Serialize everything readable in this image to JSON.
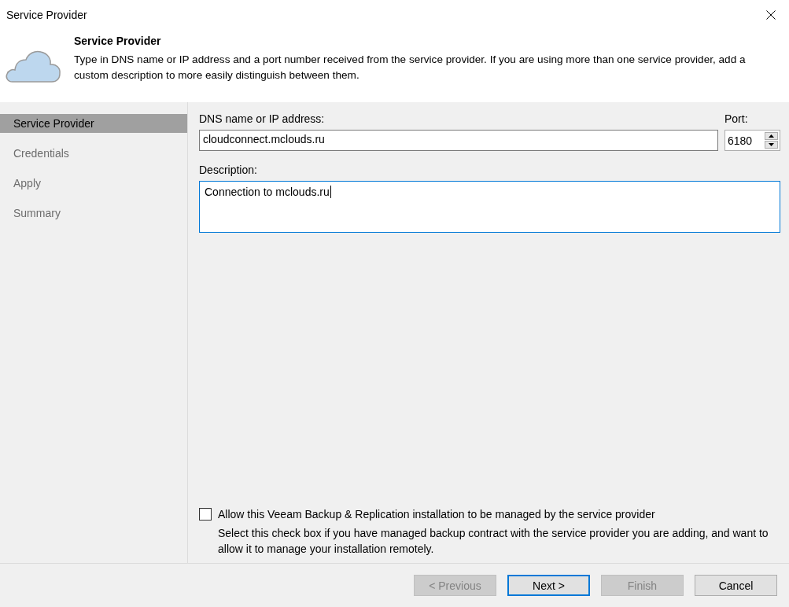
{
  "window": {
    "title": "Service Provider"
  },
  "header": {
    "title": "Service Provider",
    "description": "Type in DNS name or IP address and a port number received from the service provider. If you are using more than one service provider, add a custom description to more easily distinguish between them."
  },
  "sidebar": {
    "items": [
      {
        "label": "Service Provider",
        "selected": true
      },
      {
        "label": "Credentials",
        "selected": false
      },
      {
        "label": "Apply",
        "selected": false
      },
      {
        "label": "Summary",
        "selected": false
      }
    ]
  },
  "form": {
    "host": {
      "label": "DNS name or IP address:",
      "value": "cloudconnect.mclouds.ru"
    },
    "port": {
      "label": "Port:",
      "value": "6180"
    },
    "description": {
      "label": "Description:",
      "value": "Connection to mclouds.ru",
      "focused": true
    },
    "managed": {
      "label": "Allow this Veeam Backup & Replication installation to be managed by the service provider",
      "checked": false,
      "hint": "Select this check box if you have managed backup contract with the service provider you are adding, and want to allow it to manage your installation remotely."
    }
  },
  "buttons": [
    {
      "label": "< Previous",
      "disabled": true,
      "default": false
    },
    {
      "label": "Next >",
      "disabled": false,
      "default": true
    },
    {
      "label": "Finish",
      "disabled": true,
      "default": false
    },
    {
      "label": "Cancel",
      "disabled": false,
      "default": false
    }
  ]
}
